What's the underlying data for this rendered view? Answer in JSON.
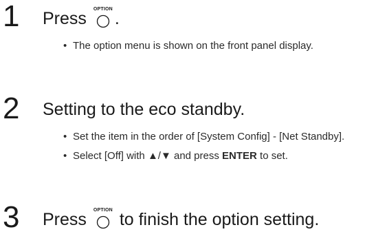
{
  "steps": [
    {
      "number": "1",
      "heading_before": "Press",
      "heading_after": ".",
      "button_label": "OPTION",
      "bullets": [
        {
          "text": "The option menu is shown on the front panel display."
        }
      ]
    },
    {
      "number": "2",
      "heading": "Setting to the eco standby.",
      "bullets": [
        {
          "text": "Set the item in the order of [System Config] - [Net Standby]."
        },
        {
          "before": "Select [Off] with ",
          "arrows": "▲/▼",
          "middle": " and press ",
          "bold": "ENTER",
          "after": " to set."
        }
      ]
    },
    {
      "number": "3",
      "heading_before": "Press",
      "heading_after": "to finish the option setting.",
      "button_label": "OPTION"
    }
  ],
  "bullet_glyph": "•"
}
